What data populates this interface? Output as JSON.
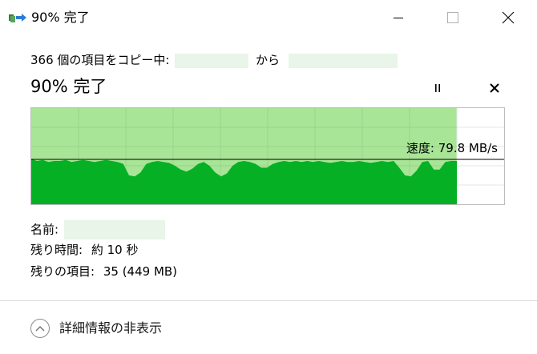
{
  "window": {
    "title": "90% 完了",
    "icon": "copy-files-icon",
    "buttons": [
      "minimize-icon",
      "maximize-icon",
      "close-icon"
    ]
  },
  "progress": {
    "copy_line_prefix": "366 個の項目をコピー中:",
    "copy_line_mid": "から",
    "status": "90% 完了",
    "percent": 90,
    "speed_label": "速度: 79.8 MB/s",
    "pause_icon": "pause-icon",
    "cancel_icon": "cancel-icon"
  },
  "chart_data": {
    "type": "area",
    "title": "",
    "xlabel": "",
    "ylabel": "",
    "progress_fraction": 0.9,
    "current_speed_mbps": 79.8,
    "speed_history_fraction_of_graph_height": [
      0.47,
      0.45,
      0.46,
      0.44,
      0.45,
      0.45,
      0.46,
      0.44,
      0.45,
      0.46,
      0.45,
      0.44,
      0.45,
      0.46,
      0.45,
      0.44,
      0.42,
      0.3,
      0.29,
      0.33,
      0.42,
      0.44,
      0.45,
      0.44,
      0.43,
      0.4,
      0.36,
      0.34,
      0.37,
      0.42,
      0.44,
      0.4,
      0.33,
      0.29,
      0.32,
      0.4,
      0.44,
      0.45,
      0.44,
      0.42,
      0.38,
      0.38,
      0.42,
      0.44,
      0.45,
      0.44,
      0.45,
      0.44,
      0.45,
      0.44,
      0.45,
      0.44,
      0.43,
      0.44,
      0.45,
      0.44,
      0.44,
      0.45,
      0.44,
      0.43,
      0.44,
      0.45,
      0.44,
      0.45,
      0.38,
      0.3,
      0.29,
      0.35,
      0.44,
      0.45,
      0.36,
      0.36,
      0.44,
      0.45,
      0.45
    ],
    "colors": {
      "progress_fill": "#a9e597",
      "speed_fill": "#06b025",
      "grid": "#9bd48a",
      "speed_line": "#000000"
    }
  },
  "file_info": {
    "name_label": "名前:",
    "time_label": "残り時間:",
    "time_value": "約 10 秒",
    "items_label": "残りの項目:",
    "items_value": "35 (449 MB)"
  },
  "footer": {
    "toggle_label": "詳細情報の非表示",
    "toggle_icon": "chevron-up-icon"
  }
}
